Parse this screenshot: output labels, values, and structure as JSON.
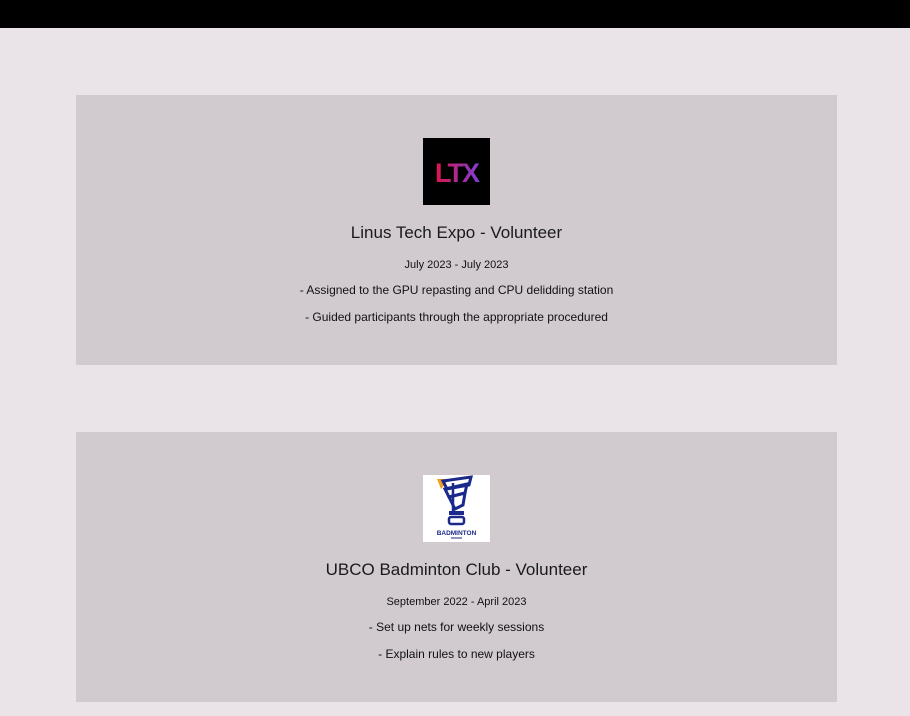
{
  "experiences": [
    {
      "title": "Linus Tech Expo - Volunteer",
      "dates": "July 2023 - July 2023",
      "bullets": [
        "- Assigned to the GPU repasting and CPU delidding station",
        "- Guided participants through the appropriate procedured"
      ],
      "logo": {
        "icon": "ltx-logo",
        "text": "LTX",
        "colors": {
          "background": "#000000",
          "gradient_start": "#e0144c",
          "gradient_end": "#7b3fd6"
        }
      }
    },
    {
      "title": "UBCO Badminton Club - Volunteer",
      "dates": "September 2022 - April 2023",
      "bullets": [
        "- Set up nets for weekly sessions",
        "- Explain rules to new players"
      ],
      "logo": {
        "icon": "badminton-club-logo",
        "text": "BADMINTON",
        "colors": {
          "background": "#ffffff",
          "primary": "#1b2a8a",
          "accent": "#f0a020"
        }
      }
    }
  ]
}
